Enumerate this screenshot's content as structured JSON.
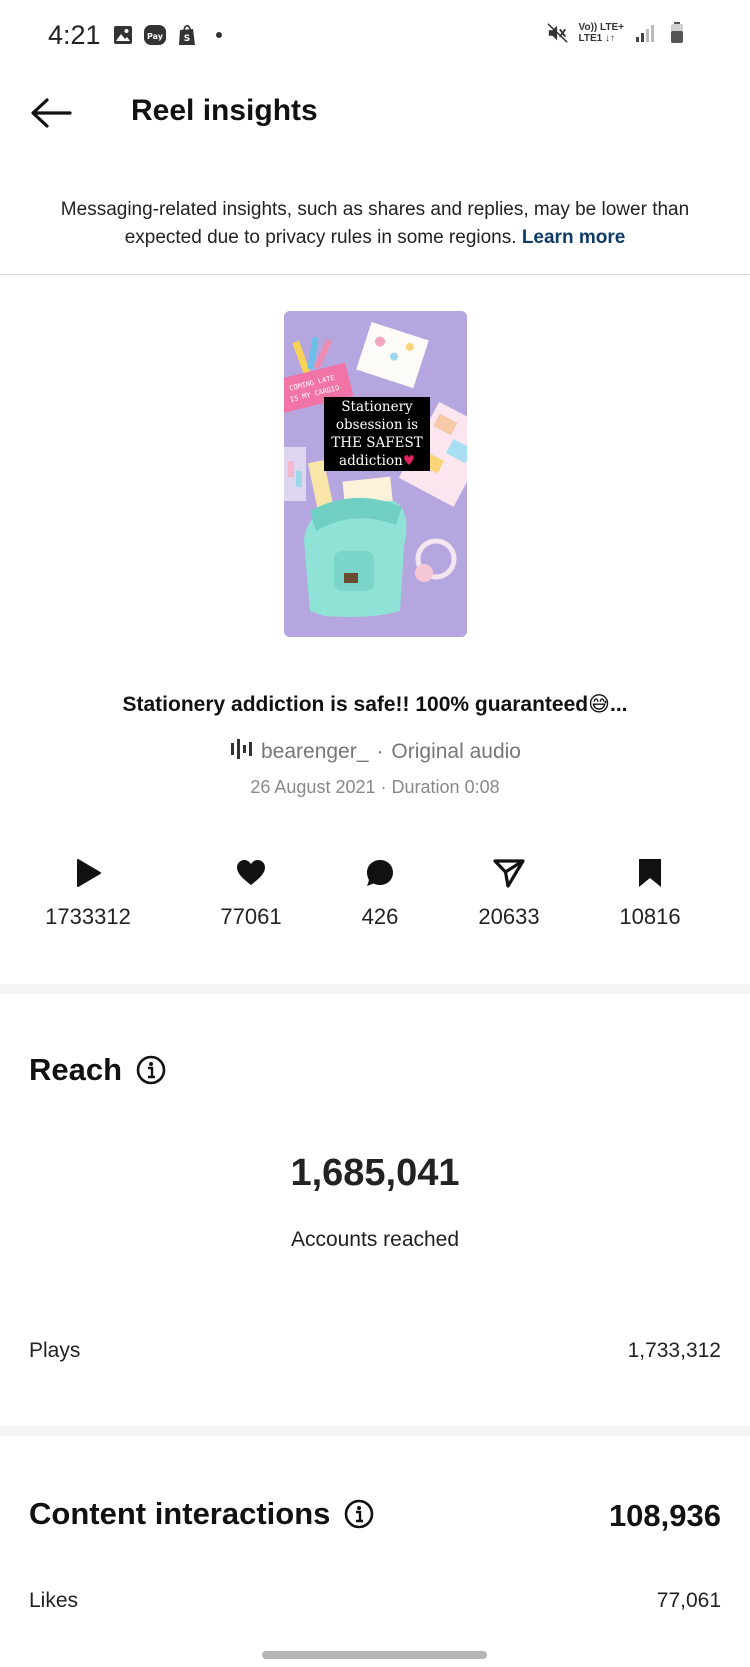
{
  "status_bar": {
    "time": "4:21",
    "network_line1": "Vo)) LTE+",
    "network_line2": "LTE1 ↓↑",
    "left_icons": [
      "gallery-icon",
      "pay-icon",
      "shopify-icon",
      "dot-icon"
    ],
    "right_icons": [
      "mute-icon",
      "signal-icon",
      "battery-icon"
    ]
  },
  "header": {
    "title": "Reel insights",
    "back_icon": "arrow-left-icon"
  },
  "notice": {
    "text": "Messaging-related insights, such as shares and replies, may be lower than expected due to privacy rules in some regions.",
    "link": "Learn more"
  },
  "reel": {
    "thumbnail_line1": "Stationery",
    "thumbnail_line2": "obsession is",
    "thumbnail_line3": "THE SAFEST",
    "thumbnail_line4": "addiction",
    "thumbnail_pouch_text": "COMING LATE / IS MY CARDIO",
    "caption": "Stationery addiction is safe!! 100% guaranteed😅...",
    "audio_owner": "bearenger_",
    "audio_sep": "·",
    "audio_label": "Original audio",
    "date": "26 August 2021",
    "meta_sep": "·",
    "duration": "Duration 0:08"
  },
  "stats": [
    {
      "icon": "play-icon",
      "value": "1733312"
    },
    {
      "icon": "heart-icon",
      "value": "77061"
    },
    {
      "icon": "comment-icon",
      "value": "426"
    },
    {
      "icon": "share-icon",
      "value": "20633"
    },
    {
      "icon": "bookmark-icon",
      "value": "10816"
    }
  ],
  "reach": {
    "title": "Reach",
    "accounts_reached": "1,685,041",
    "accounts_reached_label": "Accounts reached",
    "plays_label": "Plays",
    "plays_value": "1,733,312"
  },
  "content_interactions": {
    "title": "Content interactions",
    "total": "108,936",
    "likes_label": "Likes",
    "likes_value": "77,061"
  },
  "colors": {
    "link": "#0d3b66",
    "thumbnail_bg": "#b6a6e0",
    "backpack": "#8fe3d6"
  }
}
